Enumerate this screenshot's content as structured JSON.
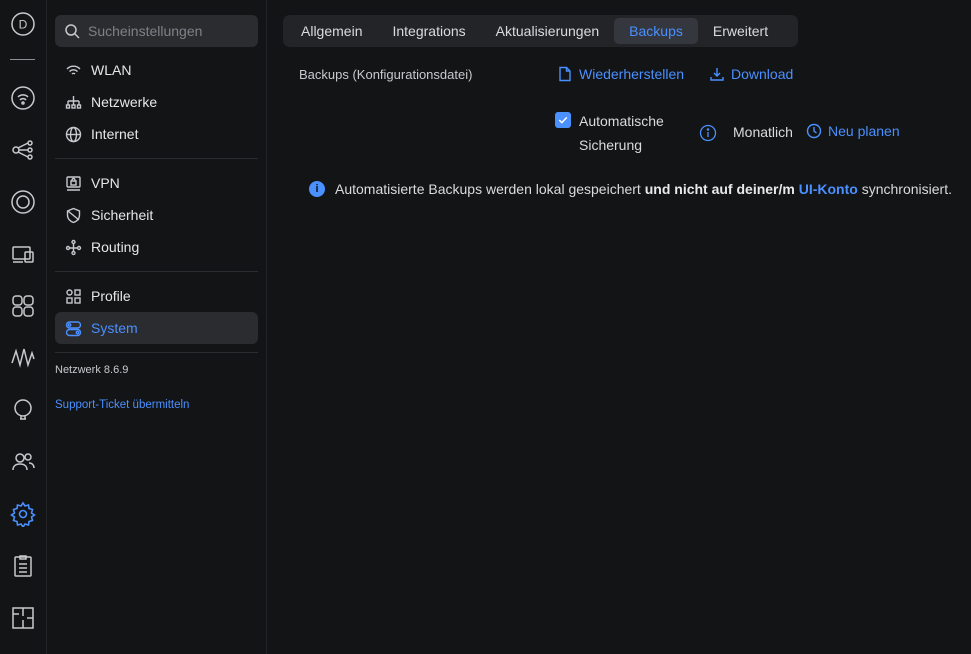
{
  "rail": {
    "logo_letter": "D",
    "icons": [
      "logo-icon",
      "wifi-device-icon",
      "topology-icon",
      "target-icon",
      "devices-icon",
      "clients-icon",
      "statistics-icon",
      "insights-icon",
      "users-icon",
      "settings-icon",
      "logs-icon",
      "floorplan-icon"
    ]
  },
  "sidebar": {
    "search_placeholder": "Sucheinstellungen",
    "items": [
      {
        "label": "WLAN",
        "icon": "wifi-icon"
      },
      {
        "label": "Netzwerke",
        "icon": "network-icon"
      },
      {
        "label": "Internet",
        "icon": "globe-icon"
      },
      {
        "label": "VPN",
        "icon": "vpn-icon"
      },
      {
        "label": "Sicherheit",
        "icon": "shield-icon"
      },
      {
        "label": "Routing",
        "icon": "routing-icon"
      },
      {
        "label": "Profile",
        "icon": "profiles-icon"
      },
      {
        "label": "System",
        "icon": "system-icon",
        "active": true
      }
    ],
    "version": "Netzwerk 8.6.9",
    "support_link": "Support-Ticket übermitteln"
  },
  "tabs": [
    {
      "label": "Allgemein"
    },
    {
      "label": "Integrations"
    },
    {
      "label": "Aktualisierungen"
    },
    {
      "label": "Backups",
      "active": true
    },
    {
      "label": "Erweitert"
    }
  ],
  "backups": {
    "section_label": "Backups (Konfigurationsdatei)",
    "restore_label": "Wiederherstellen",
    "download_label": "Download",
    "auto_backup_label": "Automatische Sicherung",
    "auto_backup_checked": true,
    "frequency": "Monatlich",
    "reschedule_label": "Neu planen",
    "notice": {
      "part1": "Automatisierte Backups werden lokal gespeichert",
      "part2": "und nicht auf deiner/m",
      "link": "UI-Konto",
      "part3": "synchronisiert."
    }
  },
  "colors": {
    "accent": "#4a90ff",
    "background": "#131416",
    "panel": "#2a2c30"
  }
}
